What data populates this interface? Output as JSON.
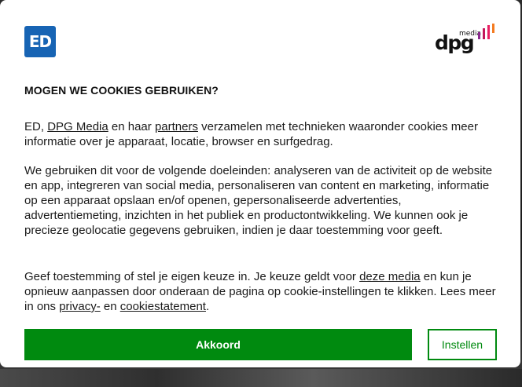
{
  "brand": {
    "site_logo_text": "ED",
    "site_logo_color": "#1764b4",
    "publisher_logo_word": "dpg",
    "publisher_logo_sub": "media",
    "publisher_bar_colors": [
      "#8b2a8f",
      "#c2185b",
      "#e91e63",
      "#f47b20"
    ]
  },
  "dialog": {
    "title": "MOGEN WE COOKIES GEBRUIKEN?",
    "p1": {
      "t1": "ED, ",
      "link_dpg": "DPG Media",
      "t2": " en haar ",
      "link_partners": "partners",
      "t3": " verzamelen met technieken waaronder cookies meer informatie over je apparaat, locatie, browser en surfgedrag."
    },
    "p2": "We gebruiken dit voor de volgende doeleinden: analyseren van de activiteit op de website en app, integreren van social media, personaliseren van content en marketing, informatie op een apparaat opslaan en/of openen, gepersonaliseerde advertenties, advertentiemeting, inzichten in het publiek en productontwikkeling. We kunnen ook je precieze geolocatie gegevens gebruiken, indien je daar toestemming voor geeft.",
    "p3": {
      "t1": "Geef toestemming of stel je eigen keuze in. Je keuze geldt voor ",
      "link_media": "deze media",
      "t2": " en kun je opnieuw aanpassen door onderaan de pagina op cookie-instellingen te klikken. Lees meer in ons ",
      "link_privacy": "privacy-",
      "t3": " en ",
      "link_cookie": "cookiestatement",
      "t4": "."
    },
    "accept_label": "Akkoord",
    "settings_label": "Instellen"
  },
  "colors": {
    "accent_green": "#008a0f"
  }
}
